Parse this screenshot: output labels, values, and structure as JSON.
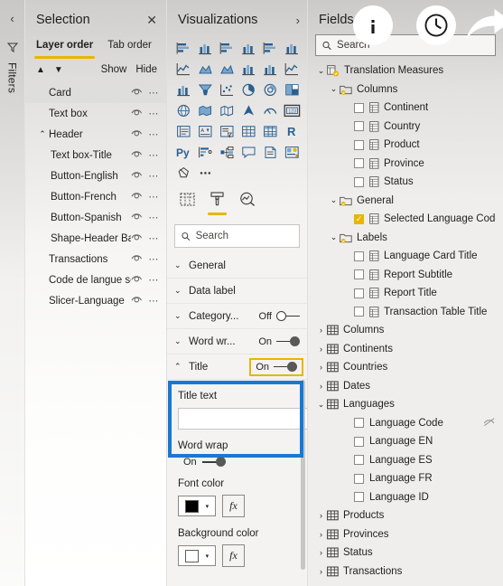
{
  "filters_rail": {
    "collapse_chevron": "‹",
    "filter_icon": "funnel-icon",
    "label": "Filters"
  },
  "selection": {
    "title": "Selection",
    "close_label": "✕",
    "tabs": [
      {
        "label": "Layer order",
        "active": true
      },
      {
        "label": "Tab order",
        "active": false
      }
    ],
    "move_up": "▲",
    "move_down": "▼",
    "show_label": "Show",
    "hide_label": "Hide",
    "layers": [
      {
        "name": "Card",
        "indent": 0,
        "caret": "",
        "selected": true
      },
      {
        "name": "Text box",
        "indent": 0,
        "caret": "",
        "selected": false
      },
      {
        "name": "Header",
        "indent": 0,
        "caret": "⌃",
        "selected": false
      },
      {
        "name": "Text box-Title",
        "indent": 2,
        "caret": "",
        "selected": false
      },
      {
        "name": "Button-English",
        "indent": 2,
        "caret": "",
        "selected": false
      },
      {
        "name": "Button-French",
        "indent": 2,
        "caret": "",
        "selected": false
      },
      {
        "name": "Button-Spanish",
        "indent": 2,
        "caret": "",
        "selected": false
      },
      {
        "name": "Shape-Header Ba...",
        "indent": 2,
        "caret": "",
        "selected": false
      },
      {
        "name": "Transactions",
        "indent": 0,
        "caret": "",
        "selected": false
      },
      {
        "name": "Code de langue sélec...",
        "indent": 0,
        "caret": "",
        "selected": false
      },
      {
        "name": "Slicer-Language",
        "indent": 0,
        "caret": "",
        "selected": false
      }
    ],
    "row_menu_dots": "⋯"
  },
  "visualizations": {
    "title": "Visualizations",
    "expand_chevron": "›",
    "icons": [
      "stacked-bar-chart-icon",
      "stacked-column-chart-icon",
      "clustered-bar-chart-icon",
      "clustered-column-chart-icon",
      "100-stacked-bar-chart-icon",
      "100-stacked-column-chart-icon",
      "line-chart-icon",
      "area-chart-icon",
      "stacked-area-chart-icon",
      "line-stacked-column-chart-icon",
      "line-clustered-column-chart-icon",
      "ribbon-chart-icon",
      "waterfall-chart-icon",
      "funnel-chart-icon",
      "scatter-chart-icon",
      "pie-chart-icon",
      "donut-chart-icon",
      "treemap-icon",
      "map-icon",
      "filled-map-icon",
      "shape-map-icon",
      "azure-map-icon",
      "gauge-icon",
      "card-icon",
      "multi-row-card-icon",
      "kpi-icon",
      "slicer-icon",
      "table-icon",
      "matrix-icon",
      "r-script-visual-icon",
      "python-visual-icon",
      "key-influencers-icon",
      "decomposition-tree-icon",
      "qa-visual-icon",
      "smart-narrative-icon",
      "paginated-report-icon",
      "get-more-visuals-icon",
      "more-options-icon"
    ],
    "format_tabs": [
      {
        "name": "fields-tab-icon",
        "active": false
      },
      {
        "name": "format-paintbrush-tab-icon",
        "active": true
      },
      {
        "name": "analytics-tab-icon",
        "active": false
      }
    ],
    "search_placeholder": "Search",
    "search_value": "",
    "sections": [
      {
        "label": "General",
        "caret": "⌄",
        "toggle": null
      },
      {
        "label": "Data label",
        "caret": "⌄",
        "toggle": null
      },
      {
        "label": "Category...",
        "caret": "⌄",
        "toggle": {
          "state": "Off",
          "on": false
        }
      },
      {
        "label": "Word wr...",
        "caret": "⌄",
        "toggle": {
          "state": "On",
          "on": true
        }
      },
      {
        "label": "Title",
        "caret": "⌃",
        "toggle": {
          "state": "On",
          "on": true
        },
        "highlighted": true
      }
    ],
    "title_text": {
      "label": "Title text",
      "value": "",
      "fx_label": "fx",
      "fx_icon": "conditional-formatting-icon"
    },
    "word_wrap": {
      "label": "Word wrap",
      "state": "On",
      "on": true
    },
    "font_color": {
      "label": "Font color",
      "swatch": "#000000",
      "fx_label": "fx",
      "caret": "▾"
    },
    "background_color": {
      "label": "Background color",
      "swatch": "#ffffff",
      "fx_label": "fx",
      "caret": "▾"
    },
    "highlight_box_color": "#1878d4",
    "accent_color": "#e8b500"
  },
  "fields": {
    "title": "Fields",
    "expand_chevron": "›",
    "search_placeholder": "Search",
    "search_value": "",
    "overlay_icons": [
      {
        "name": "info-icon",
        "glyph": "i"
      },
      {
        "name": "clock-icon",
        "glyph": "clock"
      },
      {
        "name": "share-arrow-icon",
        "glyph": "arrow"
      }
    ],
    "tree": [
      {
        "label": "Translation Measures",
        "indent": 0,
        "caret": "⌄",
        "icon": "measure-table-icon",
        "check": null
      },
      {
        "label": "Columns",
        "indent": 1,
        "caret": "⌄",
        "icon": "folder-icon",
        "check": null
      },
      {
        "label": "Continent",
        "indent": 2,
        "caret": "",
        "icon": "measure-icon",
        "check": false
      },
      {
        "label": "Country",
        "indent": 2,
        "caret": "",
        "icon": "measure-icon",
        "check": false
      },
      {
        "label": "Product",
        "indent": 2,
        "caret": "",
        "icon": "measure-icon",
        "check": false
      },
      {
        "label": "Province",
        "indent": 2,
        "caret": "",
        "icon": "measure-icon",
        "check": false
      },
      {
        "label": "Status",
        "indent": 2,
        "caret": "",
        "icon": "measure-icon",
        "check": false
      },
      {
        "label": "General",
        "indent": 1,
        "caret": "⌄",
        "icon": "folder-icon",
        "check": null
      },
      {
        "label": "Selected Language Code",
        "indent": 2,
        "caret": "",
        "icon": "measure-icon",
        "check": true
      },
      {
        "label": "Labels",
        "indent": 1,
        "caret": "⌄",
        "icon": "folder-icon",
        "check": null
      },
      {
        "label": "Language Card Title",
        "indent": 2,
        "caret": "",
        "icon": "measure-icon",
        "check": false
      },
      {
        "label": "Report Subtitle",
        "indent": 2,
        "caret": "",
        "icon": "measure-icon",
        "check": false
      },
      {
        "label": "Report Title",
        "indent": 2,
        "caret": "",
        "icon": "measure-icon",
        "check": false
      },
      {
        "label": "Transaction Table Title",
        "indent": 2,
        "caret": "",
        "icon": "measure-icon",
        "check": false
      },
      {
        "label": "Columns",
        "indent": 0,
        "caret": "›",
        "icon": "table-icon",
        "check": null
      },
      {
        "label": "Continents",
        "indent": 0,
        "caret": "›",
        "icon": "table-icon",
        "check": null
      },
      {
        "label": "Countries",
        "indent": 0,
        "caret": "›",
        "icon": "table-icon",
        "check": null
      },
      {
        "label": "Dates",
        "indent": 0,
        "caret": "›",
        "icon": "table-icon",
        "check": null
      },
      {
        "label": "Languages",
        "indent": 0,
        "caret": "⌄",
        "icon": "table-icon",
        "check": null
      },
      {
        "label": "Language Code",
        "indent": 2,
        "caret": "",
        "icon": "none",
        "check": false,
        "hidden_eye": true
      },
      {
        "label": "Language EN",
        "indent": 2,
        "caret": "",
        "icon": "none",
        "check": false
      },
      {
        "label": "Language ES",
        "indent": 2,
        "caret": "",
        "icon": "none",
        "check": false
      },
      {
        "label": "Language FR",
        "indent": 2,
        "caret": "",
        "icon": "none",
        "check": false
      },
      {
        "label": "Language ID",
        "indent": 2,
        "caret": "",
        "icon": "none",
        "check": false
      },
      {
        "label": "Products",
        "indent": 0,
        "caret": "›",
        "icon": "table-icon",
        "check": null
      },
      {
        "label": "Provinces",
        "indent": 0,
        "caret": "›",
        "icon": "table-icon",
        "check": null
      },
      {
        "label": "Status",
        "indent": 0,
        "caret": "›",
        "icon": "table-icon",
        "check": null
      },
      {
        "label": "Transactions",
        "indent": 0,
        "caret": "›",
        "icon": "table-icon",
        "check": null
      }
    ]
  }
}
